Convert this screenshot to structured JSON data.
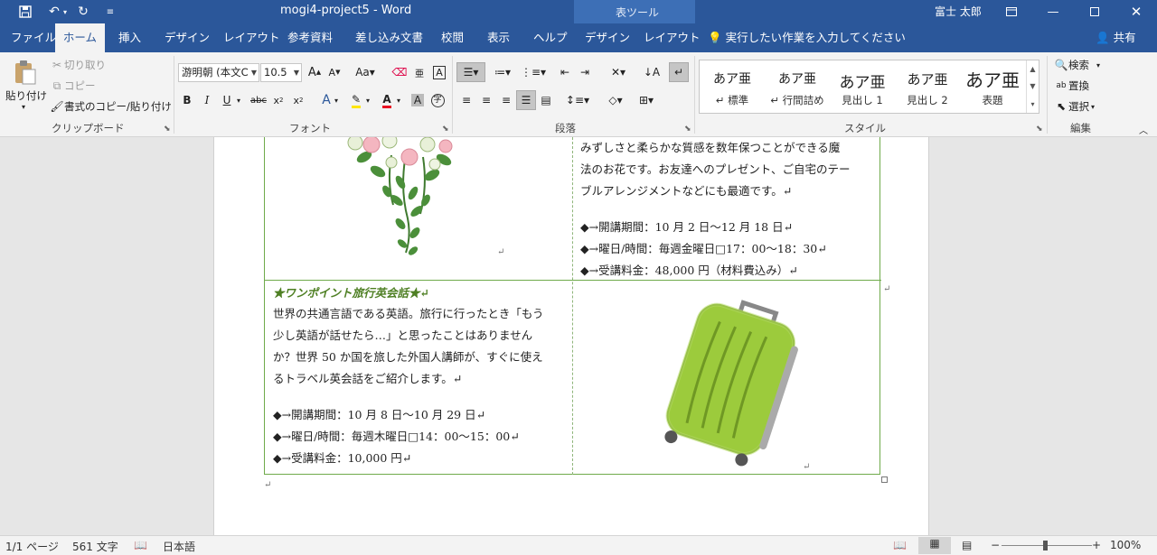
{
  "window": {
    "doc_title": "mogi4-project5  -  Word",
    "context_title": "表ツール",
    "user": "富士 太郎",
    "controls": [
      "restore-ribbon",
      "minimize",
      "maximize",
      "close"
    ]
  },
  "tabs": {
    "file": "ファイル",
    "home": "ホーム",
    "insert": "挿入",
    "design": "デザイン",
    "layout": "レイアウト",
    "references": "参考資料",
    "mailings": "差し込み文書",
    "review": "校閲",
    "view": "表示",
    "help": "ヘルプ",
    "table_design": "デザイン",
    "table_layout": "レイアウト",
    "tell_me": "実行したい作業を入力してください",
    "share": "共有"
  },
  "clipboard": {
    "paste": "貼り付け",
    "cut": "切り取り",
    "copy": "コピー",
    "format_painter": "書式のコピー/貼り付け",
    "label": "クリップボード"
  },
  "font": {
    "name": "游明朝 (本文C",
    "size": "10.5",
    "label": "フォント"
  },
  "paragraph": {
    "label": "段落"
  },
  "styles": {
    "label": "スタイル",
    "items": [
      {
        "sample": "あア亜",
        "name": "↵ 標準"
      },
      {
        "sample": "あア亜",
        "name": "↵ 行間詰め"
      },
      {
        "sample": "あア亜",
        "name": "見出し 1"
      },
      {
        "sample": "あア亜",
        "name": "見出し 2"
      },
      {
        "sample": "あア亜",
        "name": "表題"
      }
    ]
  },
  "editing": {
    "find": "検索",
    "replace": "置換",
    "select": "選択",
    "label": "編集"
  },
  "document": {
    "top_right": [
      "みずしさと柔らかな質感を数年保つことができる魔",
      "法のお花です。お友達へのプレゼント、ご自宅のテー",
      "ブルアレンジメントなどにも最適です。↵",
      "◆→開講期間：10 月 2 日〜12 月 18 日↵",
      "◆→曜日/時間：毎週金曜日□17：00〜18：30↵",
      "◆→受講料金：48,000 円（材料費込み）↵"
    ],
    "bottom_left_heading": "★ワンポイント旅行英会話★↵",
    "bottom_left": [
      "世界の共通言語である英語。旅行に行ったとき「もう",
      "少し英語が話せたら…」と思ったことはありません",
      "か？世界 50 か国を旅した外国人講師が、すぐに使え",
      "るトラベル英会話をご紹介します。↵",
      "◆→開講期間：10 月 8 日〜10 月 29 日↵",
      "◆→曜日/時間：毎週木曜日□14：00〜15：00↵",
      "◆→受講料金：10,000 円↵"
    ],
    "row_end_mark": "↵",
    "cell_mark": "↵",
    "after_table_mark": "↵"
  },
  "status": {
    "page": "1/1 ページ",
    "words": "561 文字",
    "language": "日本語",
    "zoom": "100%"
  },
  "colors": {
    "accent": "#2b579a",
    "table_border": "#6faa4b",
    "heading_green": "#4e7f23",
    "suitcase": "#9ccb3c"
  }
}
